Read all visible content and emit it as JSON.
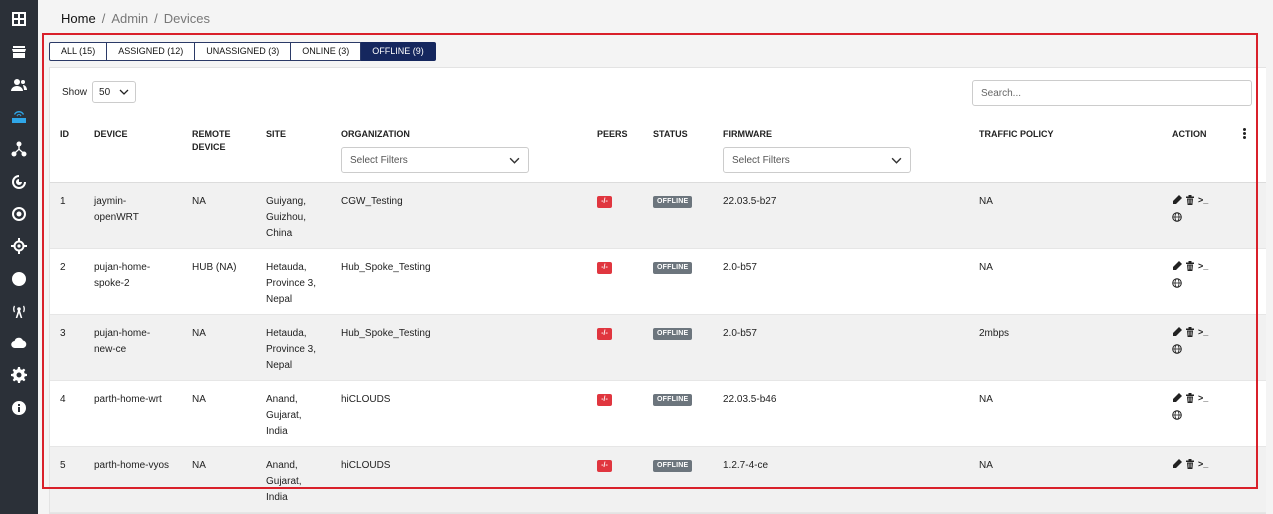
{
  "colors": {
    "sidebar": "#2b3038",
    "active_icon": "#2fa6e8",
    "tab_active": "#15275e",
    "peer_badge": "#e0363f",
    "status_badge": "#6c757d",
    "highlight": "#d9202a"
  },
  "sidebar": {
    "items": [
      {
        "icon": "dashboard-icon"
      },
      {
        "icon": "store-icon"
      },
      {
        "icon": "users-icon"
      },
      {
        "icon": "router-icon",
        "active": true
      },
      {
        "icon": "topology-icon"
      },
      {
        "icon": "radar-icon"
      },
      {
        "icon": "target-icon"
      },
      {
        "icon": "location-icon"
      },
      {
        "icon": "globe-icon"
      },
      {
        "icon": "antenna-icon"
      },
      {
        "icon": "cloud-icon"
      },
      {
        "icon": "gear-icon"
      },
      {
        "icon": "info-icon"
      }
    ]
  },
  "breadcrumb": {
    "home": "Home",
    "admin": "Admin",
    "current": "Devices",
    "separator": "/"
  },
  "tabs": [
    {
      "label": "ALL (15)"
    },
    {
      "label": "ASSIGNED (12)"
    },
    {
      "label": "UNASSIGNED (3)"
    },
    {
      "label": "ONLINE (3)"
    },
    {
      "label": "OFFLINE (9)",
      "active": true
    }
  ],
  "controls": {
    "show_label": "Show",
    "show_value": "50",
    "search_placeholder": "Search..."
  },
  "columns": {
    "id": "ID",
    "device": "DEVICE",
    "remote_device_line1": "REMOTE",
    "remote_device_line2": "DEVICE",
    "site": "SITE",
    "organization": "ORGANIZATION",
    "peers": "PEERS",
    "status": "STATUS",
    "firmware": "FIRMWARE",
    "traffic_policy": "TRAFFIC POLICY",
    "action": "ACTION"
  },
  "filters": {
    "organization_placeholder": "Select Filters",
    "firmware_placeholder": "Select Filters"
  },
  "rows": [
    {
      "id": "1",
      "device_1": "jaymin-",
      "device_2": "openWRT",
      "remote": "NA",
      "site_1": "Guiyang,",
      "site_2": "Guizhou,",
      "site_3": "China",
      "org": "CGW_Testing",
      "peers": "-/-",
      "status": "OFFLINE",
      "firmware": "22.03.5-b27",
      "policy": "NA",
      "terminal": ">_"
    },
    {
      "id": "2",
      "device_1": "pujan-home-",
      "device_2": "spoke-2",
      "remote": "HUB (NA)",
      "site_1": "Hetauda,",
      "site_2": "Province 3,",
      "site_3": "Nepal",
      "org": "Hub_Spoke_Testing",
      "peers": "-/-",
      "status": "OFFLINE",
      "firmware": "2.0-b57",
      "policy": "NA",
      "terminal": ">_"
    },
    {
      "id": "3",
      "device_1": "pujan-home-",
      "device_2": "new-ce",
      "remote": "NA",
      "site_1": "Hetauda,",
      "site_2": "Province 3,",
      "site_3": "Nepal",
      "org": "Hub_Spoke_Testing",
      "peers": "-/-",
      "status": "OFFLINE",
      "firmware": "2.0-b57",
      "policy": "2mbps",
      "terminal": ">_"
    },
    {
      "id": "4",
      "device_1": "parth-home-wrt",
      "device_2": "",
      "remote": "NA",
      "site_1": "Anand,",
      "site_2": "Gujarat,",
      "site_3": "India",
      "org": "hiCLOUDS",
      "peers": "-/-",
      "status": "OFFLINE",
      "firmware": "22.03.5-b46",
      "policy": "NA",
      "terminal": ">_"
    },
    {
      "id": "5",
      "device_1": "parth-home-vyos",
      "device_2": "",
      "remote": "NA",
      "site_1": "Anand,",
      "site_2": "Gujarat,",
      "site_3": "India",
      "org": "hiCLOUDS",
      "peers": "-/-",
      "status": "OFFLINE",
      "firmware": "1.2.7-4-ce",
      "policy": "NA",
      "terminal": ">_"
    }
  ]
}
